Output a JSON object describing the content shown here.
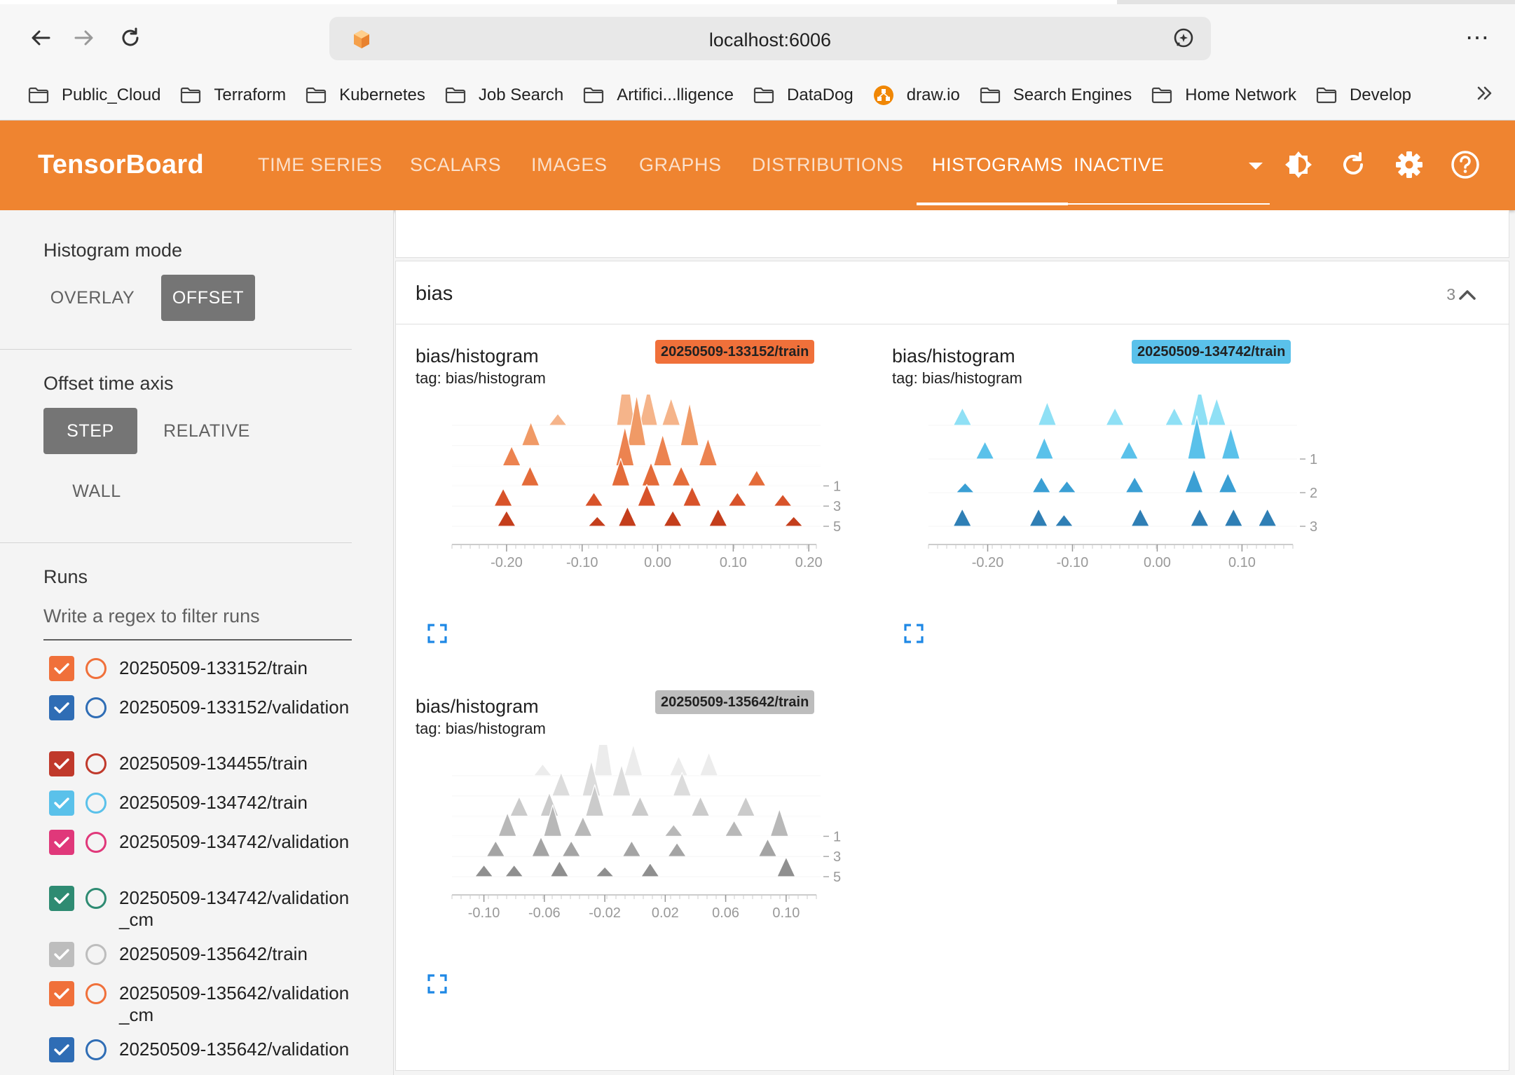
{
  "browser": {
    "url": "localhost:6006",
    "bookmarks": [
      {
        "label": "Public_Cloud",
        "icon": "folder-icon"
      },
      {
        "label": "Terraform",
        "icon": "folder-icon"
      },
      {
        "label": "Kubernetes",
        "icon": "folder-icon"
      },
      {
        "label": "Job Search",
        "icon": "folder-icon"
      },
      {
        "label": "Artifici...lligence",
        "icon": "folder-icon"
      },
      {
        "label": "DataDog",
        "icon": "folder-icon"
      },
      {
        "label": "draw.io",
        "icon": "drawio-icon"
      },
      {
        "label": "Search Engines",
        "icon": "folder-icon"
      },
      {
        "label": "Home Network",
        "icon": "folder-icon"
      },
      {
        "label": "Develop",
        "icon": "folder-icon"
      }
    ]
  },
  "header": {
    "title": "TensorBoard",
    "tabs": [
      "TIME SERIES",
      "SCALARS",
      "IMAGES",
      "GRAPHS",
      "DISTRIBUTIONS",
      "HISTOGRAMS"
    ],
    "active_tab": "HISTOGRAMS",
    "inactive_label": "INACTIVE",
    "color": "#ef8430"
  },
  "sidebar": {
    "histogram_mode": {
      "title": "Histogram mode",
      "options": [
        "OVERLAY",
        "OFFSET"
      ],
      "selected": "OFFSET"
    },
    "offset_axis": {
      "title": "Offset time axis",
      "options": [
        "STEP",
        "RELATIVE",
        "WALL"
      ],
      "selected": "STEP"
    },
    "runs": {
      "title": "Runs",
      "filter_placeholder": "Write a regex to filter runs",
      "items": [
        {
          "label": "20250509-133152/train",
          "color": "#f0703a",
          "checked": true
        },
        {
          "label": "20250509-133152/validation",
          "color": "#2f6db5",
          "checked": true
        },
        {
          "label": "20250509-134455/train",
          "color": "#c0392b",
          "checked": true
        },
        {
          "label": "20250509-134742/train",
          "color": "#5ac1ea",
          "checked": true
        },
        {
          "label": "20250509-134742/validation",
          "color": "#e0387a",
          "checked": true
        },
        {
          "label": "20250509-134742/validation_cm",
          "color": "#2e8b72",
          "checked": true
        },
        {
          "label": "20250509-135642/train",
          "color": "#bdbdbd",
          "checked": true
        },
        {
          "label": "20250509-135642/validation_cm",
          "color": "#f0703a",
          "checked": true
        },
        {
          "label": "20250509-135642/validation",
          "color": "#2f6db5",
          "checked": true
        }
      ]
    }
  },
  "main": {
    "group": {
      "name": "bias",
      "count": "3"
    },
    "cards": [
      {
        "title": "bias/histogram",
        "tag": "tag: bias/histogram",
        "run": "20250509-133152/train",
        "badge_color": "#f0703a"
      },
      {
        "title": "bias/histogram",
        "tag": "tag: bias/histogram",
        "run": "20250509-134742/train",
        "badge_color": "#5ac1ea"
      },
      {
        "title": "bias/histogram",
        "tag": "tag: bias/histogram",
        "run": "20250509-135642/train",
        "badge_color": "#bdbdbd"
      }
    ]
  },
  "chart_data": [
    {
      "type": "area",
      "mode": "offset",
      "run": "20250509-133152/train",
      "xlim": [
        -0.25,
        0.21
      ],
      "x_ticks": [
        "-0.20",
        "-0.10",
        "0.00",
        "0.10",
        "0.20"
      ],
      "step_ticks": [
        "1",
        "3",
        "5"
      ],
      "steps": [
        0,
        1,
        2,
        3,
        4,
        5
      ],
      "colors": [
        "#f5b48a",
        "#f09a66",
        "#ec8350",
        "#e46c3a",
        "#d8532a",
        "#c43e1c"
      ],
      "peaks": [
        [
          [
            -0.11,
            0.6
          ],
          [
            -0.02,
            3.2
          ],
          [
            0.01,
            2.0
          ],
          [
            0.04,
            1.4
          ]
        ],
        [
          [
            -0.15,
            1.2
          ],
          [
            -0.01,
            2.6
          ],
          [
            0.06,
            2.2
          ]
        ],
        [
          [
            -0.18,
            1.0
          ],
          [
            -0.03,
            2.0
          ],
          [
            0.02,
            1.6
          ],
          [
            0.08,
            1.4
          ]
        ],
        [
          [
            -0.16,
            1.0
          ],
          [
            -0.04,
            1.4
          ],
          [
            0.0,
            1.2
          ],
          [
            0.04,
            1.0
          ],
          [
            0.14,
            0.8
          ]
        ],
        [
          [
            -0.2,
            0.9
          ],
          [
            -0.08,
            0.7
          ],
          [
            -0.01,
            1.1
          ],
          [
            0.05,
            1.0
          ],
          [
            0.11,
            0.7
          ],
          [
            0.17,
            0.6
          ]
        ],
        [
          [
            -0.2,
            0.8
          ],
          [
            -0.08,
            0.5
          ],
          [
            -0.04,
            1.0
          ],
          [
            0.02,
            0.8
          ],
          [
            0.08,
            0.9
          ],
          [
            0.18,
            0.5
          ]
        ]
      ]
    },
    {
      "type": "area",
      "mode": "offset",
      "run": "20250509-134742/train",
      "xlim": [
        -0.25,
        0.16
      ],
      "x_ticks": [
        "-0.20",
        "-0.10",
        "0.00",
        "0.10"
      ],
      "step_ticks": [
        "1",
        "2",
        "3"
      ],
      "steps": [
        0,
        1,
        2,
        3
      ],
      "colors": [
        "#8fe0f5",
        "#5ac1ea",
        "#3a9fd4",
        "#2f7fb5"
      ],
      "peaks": [
        [
          [
            -0.21,
            0.9
          ],
          [
            -0.11,
            1.2
          ],
          [
            -0.03,
            0.9
          ],
          [
            0.04,
            0.9
          ],
          [
            0.07,
            2.0
          ],
          [
            0.09,
            1.4
          ]
        ],
        [
          [
            -0.19,
            0.9
          ],
          [
            -0.12,
            1.1
          ],
          [
            -0.02,
            0.9
          ],
          [
            0.06,
            2.2
          ],
          [
            0.1,
            1.6
          ]
        ],
        [
          [
            -0.22,
            0.5
          ],
          [
            -0.13,
            0.8
          ],
          [
            -0.1,
            0.6
          ],
          [
            -0.02,
            0.8
          ],
          [
            0.05,
            1.2
          ],
          [
            0.09,
            1.0
          ]
        ],
        [
          [
            -0.23,
            0.9
          ],
          [
            -0.14,
            0.9
          ],
          [
            -0.11,
            0.6
          ],
          [
            -0.02,
            0.9
          ],
          [
            0.05,
            0.9
          ],
          [
            0.09,
            0.9
          ],
          [
            0.13,
            0.9
          ]
        ]
      ]
    },
    {
      "type": "area",
      "mode": "offset",
      "run": "20250509-135642/train",
      "xlim": [
        -0.11,
        0.12
      ],
      "x_ticks": [
        "-0.10",
        "-0.06",
        "-0.02",
        "0.02",
        "0.06",
        "0.10"
      ],
      "step_ticks": [
        "1",
        "3",
        "5"
      ],
      "steps": [
        0,
        1,
        2,
        3,
        4,
        5
      ],
      "colors": [
        "#ececec",
        "#dcdcdc",
        "#cbcbcb",
        "#b8b8b8",
        "#a4a4a4",
        "#8f8f8f"
      ],
      "peaks": [
        [
          [
            -0.05,
            0.6
          ],
          [
            -0.01,
            3.0
          ],
          [
            0.01,
            1.6
          ],
          [
            0.04,
            1.0
          ],
          [
            0.06,
            1.2
          ]
        ],
        [
          [
            -0.04,
            1.2
          ],
          [
            -0.02,
            1.8
          ],
          [
            0.0,
            1.6
          ],
          [
            0.04,
            1.2
          ]
        ],
        [
          [
            -0.07,
            1.0
          ],
          [
            -0.05,
            1.2
          ],
          [
            -0.02,
            1.6
          ],
          [
            0.01,
            1.0
          ],
          [
            0.05,
            1.0
          ],
          [
            0.08,
            1.0
          ]
        ],
        [
          [
            -0.08,
            1.2
          ],
          [
            -0.05,
            1.6
          ],
          [
            -0.03,
            1.0
          ],
          [
            0.03,
            0.6
          ],
          [
            0.07,
            0.8
          ],
          [
            0.1,
            1.4
          ]
        ],
        [
          [
            -0.09,
            0.8
          ],
          [
            -0.06,
            1.0
          ],
          [
            -0.04,
            0.8
          ],
          [
            0.0,
            0.8
          ],
          [
            0.03,
            0.7
          ],
          [
            0.09,
            0.9
          ]
        ],
        [
          [
            -0.1,
            0.6
          ],
          [
            -0.08,
            0.6
          ],
          [
            -0.05,
            0.8
          ],
          [
            -0.02,
            0.5
          ],
          [
            0.01,
            0.7
          ],
          [
            0.1,
            1.0
          ]
        ]
      ]
    }
  ]
}
